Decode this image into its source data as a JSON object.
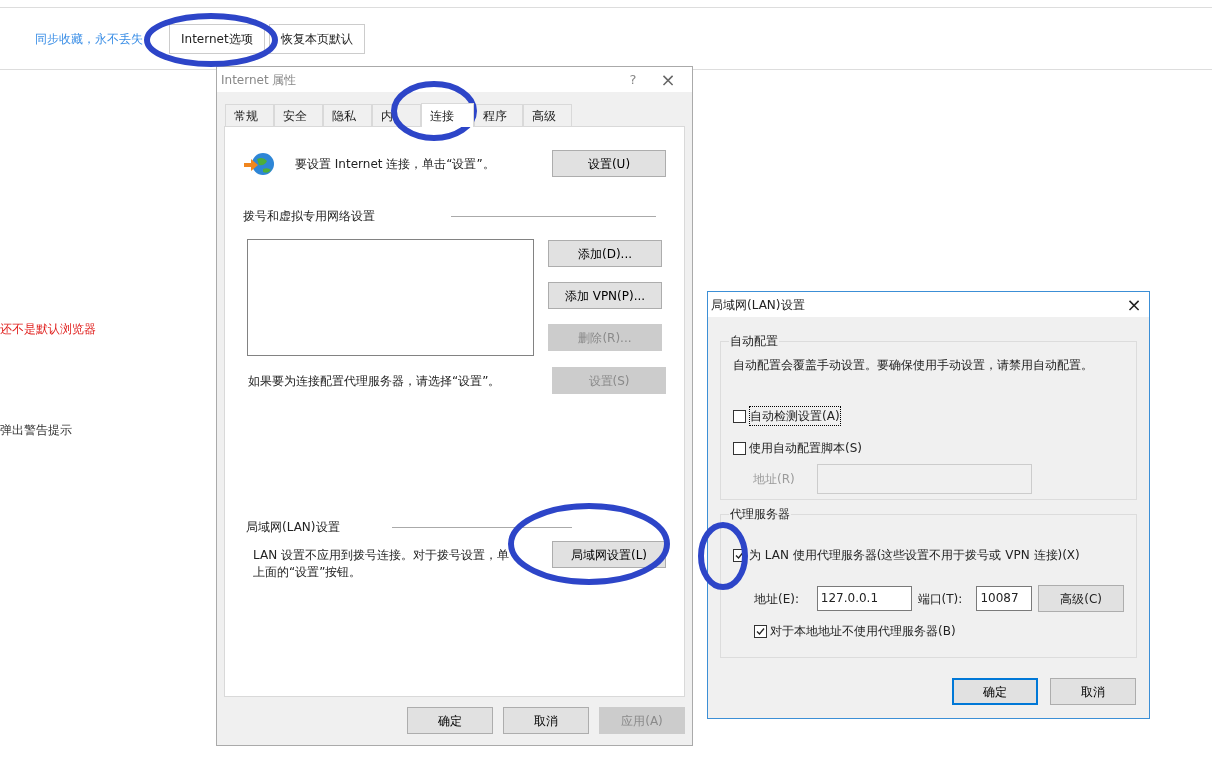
{
  "page": {
    "sync_link": "同步收藏，永不丢失",
    "buttons": [
      {
        "label": "Internet选项"
      },
      {
        "label": "恢复本页默认"
      }
    ],
    "default_warning": "还不是默认浏览器",
    "popup_label": "弹出警告提示"
  },
  "internet_dialog": {
    "title": "Internet 属性",
    "help": "?",
    "close": "×",
    "tabs": [
      {
        "label": "常规",
        "selected": false
      },
      {
        "label": "安全",
        "selected": false
      },
      {
        "label": "隐私",
        "selected": false
      },
      {
        "label": "内",
        "selected": false
      },
      {
        "label": "连接",
        "selected": true
      },
      {
        "label": "程序",
        "selected": false
      },
      {
        "label": "高级",
        "selected": false
      }
    ],
    "setup_text": "要设置 Internet 连接，单击“设置”。",
    "setup_button": {
      "label": "设置(U)",
      "disabled": false
    },
    "vpn_heading": "拨号和虚拟专用网络设置",
    "vpn_buttons": [
      {
        "label": "添加(D)...",
        "disabled": false
      },
      {
        "label": "添加 VPN(P)...",
        "disabled": false
      },
      {
        "label": "删除(R)...",
        "disabled": true
      }
    ],
    "proxy_hint": "如果要为连接配置代理服务器，请选择“设置”。",
    "proxy_button": {
      "label": "设置(S)",
      "disabled": true
    },
    "lan_heading": "局域网(LAN)设置",
    "lan_text": "LAN 设置不应用到拨号连接。对于拨号设置，单",
    "lan_text_2": "上面的“设置”按钮。",
    "lan_button": {
      "label": "局域网设置(L)",
      "disabled": false
    },
    "footer_buttons": [
      {
        "label": "确定",
        "disabled": false
      },
      {
        "label": "取消",
        "disabled": false
      },
      {
        "label": "应用(A)",
        "disabled": true
      }
    ]
  },
  "lan_dialog": {
    "title": "局域网(LAN)设置",
    "close": "×",
    "auto_group": {
      "title": "自动配置",
      "text": "自动配置会覆盖手动设置。要确保使用手动设置，请禁用自动配置。",
      "options": [
        {
          "label": "自动检测设置(A)",
          "checked": false
        },
        {
          "label": "使用自动配置脚本(S)",
          "checked": false
        }
      ],
      "address_label": "地址(R)"
    },
    "proxy_group": {
      "title": "代理服务器",
      "use_proxy": {
        "label": "为 LAN 使用代理服务器(这些设置不用于拨号或 VPN 连接)(X)",
        "checked": true
      },
      "address_label": "地址(E):",
      "address": "127.0.0.1",
      "port_label": "端口(T):",
      "port": "10087",
      "advanced_button": "高级(C)",
      "bypass_local": {
        "label": "对于本地地址不使用代理服务器(B)",
        "checked": true
      }
    },
    "footer_buttons": [
      {
        "label": "确定",
        "default": true
      },
      {
        "label": "取消",
        "default": false
      }
    ]
  }
}
